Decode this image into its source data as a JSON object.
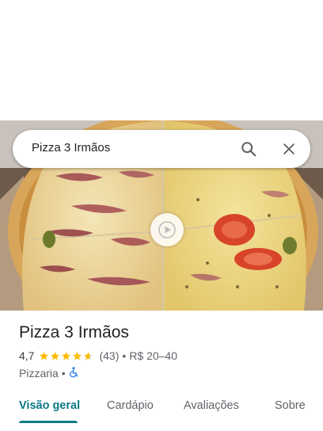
{
  "search": {
    "value": "Pizza 3 Irmãos"
  },
  "place": {
    "name": "Pizza 3 Irmãos",
    "rating": "4,7",
    "stars_filled": 4.7,
    "reviews": "(43)",
    "price": "R$ 20–40",
    "category": "Pizzaria",
    "separator": "•"
  },
  "tabs": [
    {
      "label": "Visão geral",
      "active": true
    },
    {
      "label": "Cardápio",
      "active": false
    },
    {
      "label": "Avaliações",
      "active": false
    },
    {
      "label": "Sobre",
      "active": false
    }
  ],
  "icons": {
    "search": "search-icon",
    "close": "close-icon",
    "play": "play-icon",
    "accessible": "wheelchair-icon",
    "star": "star-icon"
  },
  "colors": {
    "accent": "#0b7a85",
    "star": "#fbbc04",
    "accessibility": "#1a73e8"
  }
}
